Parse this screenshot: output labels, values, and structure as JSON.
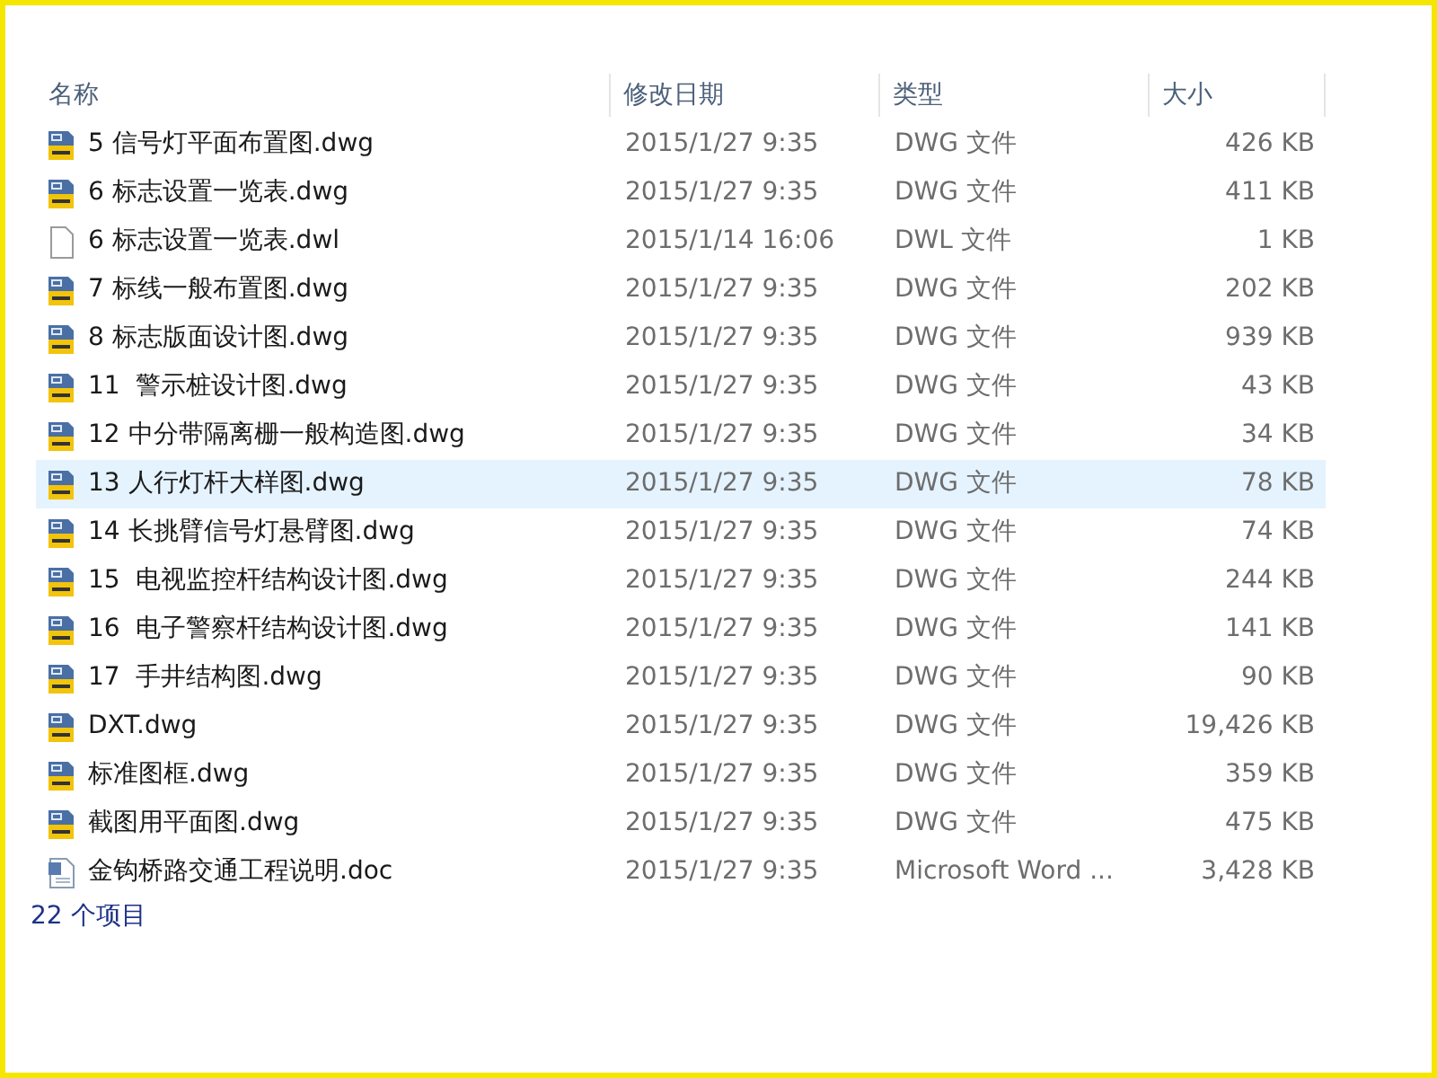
{
  "columns": [
    "名称",
    "修改日期",
    "类型",
    "大小"
  ],
  "files": [
    {
      "kind": "dwg",
      "name": "5 信号灯平面布置图.dwg",
      "modified": "2015/1/27 9:35",
      "type": "DWG 文件",
      "size": "426 KB",
      "selected": false
    },
    {
      "kind": "dwg",
      "name": "6 标志设置一览表.dwg",
      "modified": "2015/1/27 9:35",
      "type": "DWG 文件",
      "size": "411 KB",
      "selected": false
    },
    {
      "kind": "blank",
      "name": "6 标志设置一览表.dwl",
      "modified": "2015/1/14 16:06",
      "type": "DWL 文件",
      "size": "1 KB",
      "selected": false
    },
    {
      "kind": "dwg",
      "name": "7 标线一般布置图.dwg",
      "modified": "2015/1/27 9:35",
      "type": "DWG 文件",
      "size": "202 KB",
      "selected": false
    },
    {
      "kind": "dwg",
      "name": "8 标志版面设计图.dwg",
      "modified": "2015/1/27 9:35",
      "type": "DWG 文件",
      "size": "939 KB",
      "selected": false
    },
    {
      "kind": "dwg",
      "name": "11  警示桩设计图.dwg",
      "modified": "2015/1/27 9:35",
      "type": "DWG 文件",
      "size": "43 KB",
      "selected": false
    },
    {
      "kind": "dwg",
      "name": "12 中分带隔离栅一般构造图.dwg",
      "modified": "2015/1/27 9:35",
      "type": "DWG 文件",
      "size": "34 KB",
      "selected": false
    },
    {
      "kind": "dwg",
      "name": "13 人行灯杆大样图.dwg",
      "modified": "2015/1/27 9:35",
      "type": "DWG 文件",
      "size": "78 KB",
      "selected": true
    },
    {
      "kind": "dwg",
      "name": "14 长挑臂信号灯悬臂图.dwg",
      "modified": "2015/1/27 9:35",
      "type": "DWG 文件",
      "size": "74 KB",
      "selected": false
    },
    {
      "kind": "dwg",
      "name": "15  电视监控杆结构设计图.dwg",
      "modified": "2015/1/27 9:35",
      "type": "DWG 文件",
      "size": "244 KB",
      "selected": false
    },
    {
      "kind": "dwg",
      "name": "16  电子警察杆结构设计图.dwg",
      "modified": "2015/1/27 9:35",
      "type": "DWG 文件",
      "size": "141 KB",
      "selected": false
    },
    {
      "kind": "dwg",
      "name": "17  手井结构图.dwg",
      "modified": "2015/1/27 9:35",
      "type": "DWG 文件",
      "size": "90 KB",
      "selected": false
    },
    {
      "kind": "dwg",
      "name": "DXT.dwg",
      "modified": "2015/1/27 9:35",
      "type": "DWG 文件",
      "size": "19,426 KB",
      "selected": false
    },
    {
      "kind": "dwg",
      "name": "标准图框.dwg",
      "modified": "2015/1/27 9:35",
      "type": "DWG 文件",
      "size": "359 KB",
      "selected": false
    },
    {
      "kind": "dwg",
      "name": "截图用平面图.dwg",
      "modified": "2015/1/27 9:35",
      "type": "DWG 文件",
      "size": "475 KB",
      "selected": false
    },
    {
      "kind": "doc",
      "name": "金钩桥路交通工程说明.doc",
      "modified": "2015/1/27 9:35",
      "type": "Microsoft Word ...",
      "size": "3,428 KB",
      "selected": false
    }
  ],
  "status_bar": "22 个项目"
}
